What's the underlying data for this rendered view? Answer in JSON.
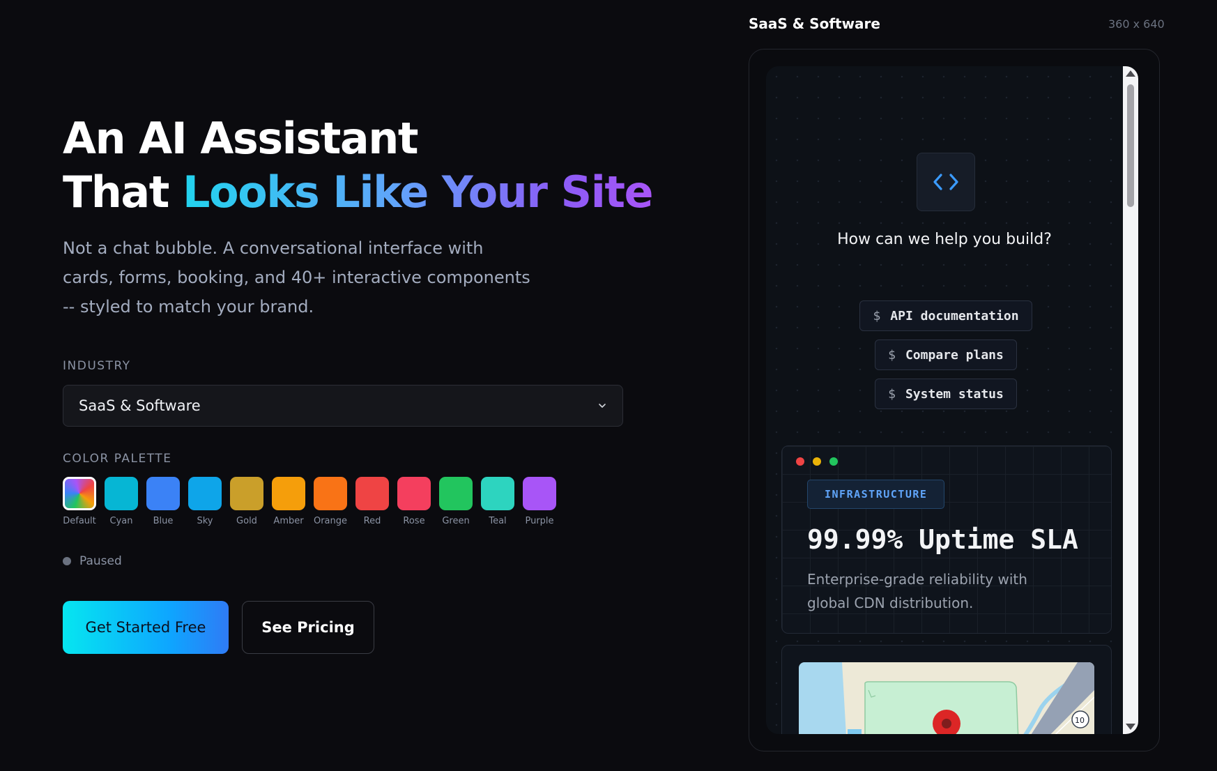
{
  "hero": {
    "title_line1": "An AI Assistant",
    "title_line2_plain": "That ",
    "title_line2_gradient": "Looks Like Your Site",
    "subtitle": "Not a chat bubble. A conversational interface with cards, forms, booking, and 40+ interactive components -- styled to match your brand."
  },
  "industry": {
    "label": "INDUSTRY",
    "selected": "SaaS & Software"
  },
  "palette": {
    "label": "COLOR PALETTE",
    "selected": "Default",
    "swatches": [
      {
        "name": "Default",
        "color": "gradient"
      },
      {
        "name": "Cyan",
        "color": "#06b6d4"
      },
      {
        "name": "Blue",
        "color": "#3b82f6"
      },
      {
        "name": "Sky",
        "color": "#0ea5e9"
      },
      {
        "name": "Gold",
        "color": "#ca9f2a"
      },
      {
        "name": "Amber",
        "color": "#f59e0b"
      },
      {
        "name": "Orange",
        "color": "#f97316"
      },
      {
        "name": "Red",
        "color": "#ef4444"
      },
      {
        "name": "Rose",
        "color": "#f43f5e"
      },
      {
        "name": "Green",
        "color": "#22c55e"
      },
      {
        "name": "Teal",
        "color": "#2dd4bf"
      },
      {
        "name": "Purple",
        "color": "#a855f7"
      }
    ]
  },
  "status": {
    "text": "Paused"
  },
  "buttons": {
    "primary": "Get Started Free",
    "secondary": "See Pricing"
  },
  "preview": {
    "title": "SaaS & Software",
    "size": "360 x 640",
    "help_title": "How can we help you build?",
    "chips": [
      {
        "prefix": "$",
        "label": "API documentation"
      },
      {
        "prefix": "$",
        "label": "Compare plans"
      },
      {
        "prefix": "$",
        "label": "System status"
      }
    ],
    "card": {
      "badge": "INFRASTRUCTURE",
      "title": "99.99% Uptime SLA",
      "description": "Enterprise-grade reliability with global CDN distribution."
    },
    "map": {
      "road_label": "xpy",
      "shield_number": "10"
    }
  },
  "colors": {
    "background": "#0b0b0f",
    "accent_cyan": "#22d3ee",
    "accent_purple": "#a855f7",
    "badge_blue": "#60a5fa"
  }
}
